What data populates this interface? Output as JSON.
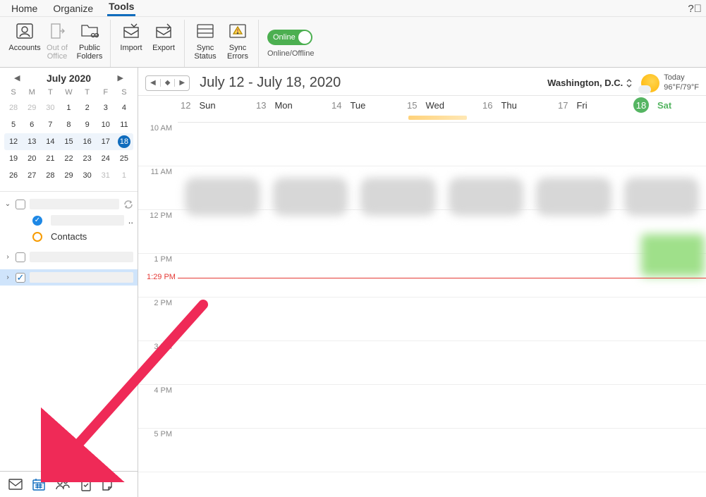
{
  "tabs": {
    "home": "Home",
    "organize": "Organize",
    "tools": "Tools"
  },
  "ribbon": {
    "accounts": "Accounts",
    "out_of_office": "Out of\nOffice",
    "public_folders": "Public\nFolders",
    "import": "Import",
    "export": "Export",
    "sync_status": "Sync\nStatus",
    "sync_errors": "Sync\nErrors",
    "online_label": "Online",
    "online_offline": "Online/Offline"
  },
  "mini_cal": {
    "title": "July 2020",
    "dow": [
      "S",
      "M",
      "T",
      "W",
      "T",
      "F",
      "S"
    ],
    "rows": [
      {
        "other_start": 2,
        "days": [
          28,
          29,
          30,
          1,
          2,
          3,
          4
        ]
      },
      {
        "days": [
          5,
          6,
          7,
          8,
          9,
          10,
          11
        ]
      },
      {
        "thisweek": true,
        "today_index": 6,
        "days": [
          12,
          13,
          14,
          15,
          16,
          17,
          18
        ]
      },
      {
        "days": [
          19,
          20,
          21,
          22,
          23,
          24,
          25
        ]
      },
      {
        "other_end": 5,
        "days": [
          26,
          27,
          28,
          29,
          30,
          31,
          1
        ]
      }
    ]
  },
  "sidebar": {
    "group1_label": "––––––––––",
    "group1_item1": "––––––––––––",
    "group1_item1_suffix": "..",
    "group1_contacts": "Contacts",
    "group2_label": "––––––––––––",
    "group3_label": "––––––––––––"
  },
  "main": {
    "range_title": "July 12 - July 18, 2020",
    "location": "Washington,  D.C.",
    "weather_today": "Today",
    "weather_temp": "96°F/79°F",
    "days": [
      {
        "num": "12",
        "name": "Sun"
      },
      {
        "num": "13",
        "name": "Mon"
      },
      {
        "num": "14",
        "name": "Tue"
      },
      {
        "num": "15",
        "name": "Wed"
      },
      {
        "num": "16",
        "name": "Thu"
      },
      {
        "num": "17",
        "name": "Fri"
      },
      {
        "num": "18",
        "name": "Sat",
        "today": true
      }
    ],
    "times": [
      "10 AM",
      "11 AM",
      "12 PM",
      "1 PM",
      "2 PM",
      "3 PM",
      "4 PM",
      "5 PM"
    ],
    "now_time": "1:29 PM"
  }
}
